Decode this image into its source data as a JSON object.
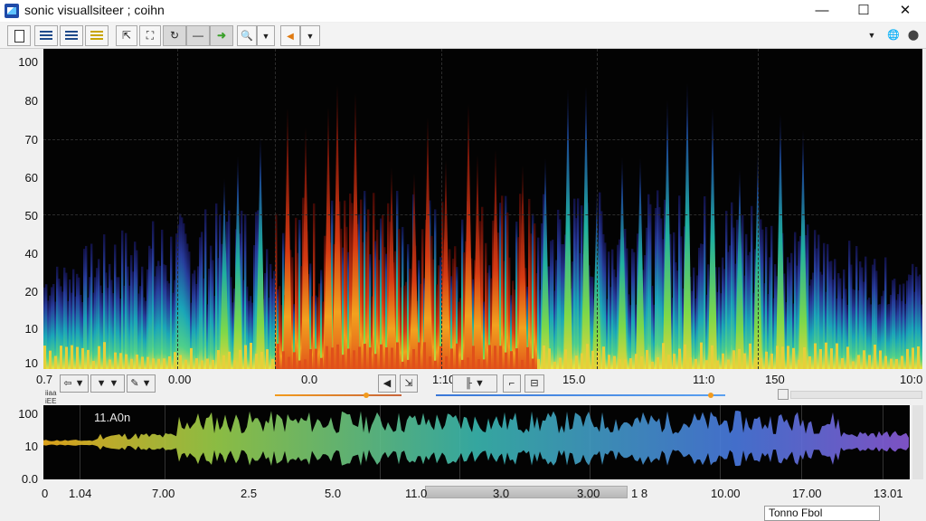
{
  "window": {
    "title": "sonic visuallsiteer ; coihn",
    "minimize": "—",
    "maximize": "☐",
    "close": "✕"
  },
  "toolbar": {
    "buttons": [
      {
        "name": "new-file-button",
        "icon": "document-icon",
        "glyph": ""
      },
      {
        "name": "pane-layout-1-button",
        "icon": "lines-icon",
        "glyph": ""
      },
      {
        "name": "pane-layout-2-button",
        "icon": "lines-icon",
        "glyph": ""
      },
      {
        "name": "pane-layout-3-button",
        "icon": "lines-yellow-icon",
        "glyph": ""
      },
      {
        "name": "navigate-tool-button",
        "icon": "navigate-icon",
        "glyph": "⇱"
      },
      {
        "name": "select-tool-button",
        "icon": "select-icon",
        "glyph": "⛶"
      },
      {
        "name": "loop-button",
        "icon": "loop-icon",
        "glyph": "↻"
      },
      {
        "name": "minus-button",
        "icon": "minus-icon",
        "glyph": "—"
      },
      {
        "name": "play-forward-button",
        "icon": "arrow-right-icon",
        "glyph": "➜"
      },
      {
        "name": "zoom-button",
        "icon": "magnifier-icon",
        "glyph": "🔍"
      },
      {
        "name": "zoom-dropdown",
        "icon": "chevron-down-icon",
        "glyph": "▼"
      },
      {
        "name": "rewind-button",
        "icon": "arrow-left-icon",
        "glyph": "◀"
      },
      {
        "name": "rewind-dropdown",
        "icon": "chevron-down-icon",
        "glyph": "▼"
      }
    ],
    "right_dropdown": "▼",
    "right_globe": "🌐",
    "right_stop": "⬤"
  },
  "spectrogram": {
    "y_ticks": [
      "100",
      "80",
      "70",
      "60",
      "50",
      "40",
      "20",
      "10",
      "10"
    ],
    "x_ticks": [
      "0.7",
      "0.00",
      "0.0",
      "1:10",
      "15.0",
      "11:0",
      "150",
      "10:0"
    ]
  },
  "controls": {
    "left_group": [
      "⇦ ▼",
      "▼ ▼",
      "✎ ▼"
    ],
    "mid_group": [
      "◀",
      "⇲"
    ],
    "right_group": [
      "╟ ▼",
      "⌐",
      "⊟"
    ],
    "mini_labels": [
      "iiaa",
      "iEE"
    ],
    "slider1_value": 0.72,
    "slider2_value": 0.95
  },
  "waveform": {
    "label": "11.A0n",
    "y_ticks": [
      "100",
      "10",
      "0.0"
    ],
    "x_ticks": [
      "0",
      "1.04",
      "7.00",
      "2.5",
      "5.0",
      "11.0",
      "3.0",
      "3.00",
      "1 8",
      "10.00",
      "17.00",
      "13.01"
    ]
  },
  "status_bar": {
    "text": "Tonno Fbol"
  },
  "colors": {
    "background": "#030303",
    "accent_orange": "#f29b1d",
    "accent_blue": "#3a78d8"
  }
}
